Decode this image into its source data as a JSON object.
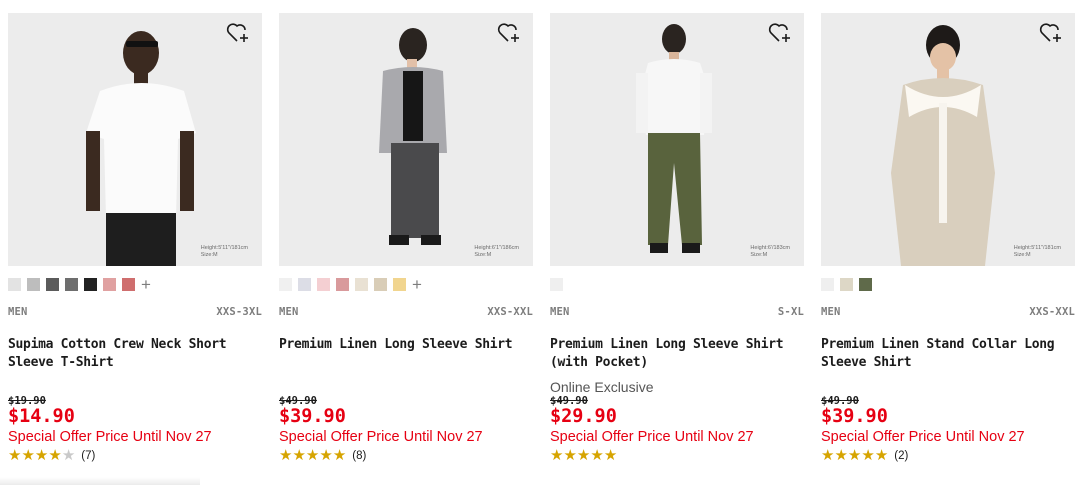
{
  "products": [
    {
      "gender": "MEN",
      "sizes": "XXS-3XL",
      "name": "Supima Cotton Crew Neck Short Sleeve T-Shirt",
      "exclusive": "",
      "old_price": "$19.90",
      "price": "$14.90",
      "offer": "Special Offer Price Until Nov 27",
      "stars": "★★★★★",
      "rating_value": 3.5,
      "reviews": "(7)",
      "model_note_1": "Height:5'11\"/181cm",
      "model_note_2": "Size:M",
      "swatches": [
        "#e3e3e3",
        "#bdbdbd",
        "#5b5b5b",
        "#6e6e6e",
        "#222222",
        "#e0a1a1",
        "#cf6e6e"
      ],
      "has_more_colors": true,
      "more_colors_label": "+"
    },
    {
      "gender": "MEN",
      "sizes": "XXS-XXL",
      "name": "Premium Linen Long Sleeve Shirt",
      "exclusive": "",
      "old_price": "$49.90",
      "price": "$39.90",
      "offer": "Special Offer Price Until Nov 27",
      "stars": "★★★★★",
      "rating_value": 5,
      "reviews": "(8)",
      "model_note_1": "Height:6'1\"/186cm",
      "model_note_2": "Size:M",
      "swatches": [
        "#f0f0f0",
        "#dcdde6",
        "#f4cfd2",
        "#d99a9c",
        "#e9e1d3",
        "#d9cdb7",
        "#f1d58f"
      ],
      "has_more_colors": true,
      "more_colors_label": "+"
    },
    {
      "gender": "MEN",
      "sizes": "S-XL",
      "name": "Premium Linen Long Sleeve Shirt (with Pocket)",
      "exclusive": "Online Exclusive",
      "old_price": "$49.90",
      "price": "$29.90",
      "offer": "Special Offer Price Until Nov 27",
      "stars": "★★★★★",
      "rating_value": 5,
      "reviews": "",
      "model_note_1": "Height:6'/183cm",
      "model_note_2": "Size:M",
      "swatches": [
        "#efefef"
      ],
      "has_more_colors": false,
      "more_colors_label": ""
    },
    {
      "gender": "MEN",
      "sizes": "XXS-XXL",
      "name": "Premium Linen Stand Collar Long Sleeve Shirt",
      "exclusive": "",
      "old_price": "$49.90",
      "price": "$39.90",
      "offer": "Special Offer Price Until Nov 27",
      "stars": "★★★★★",
      "rating_value": 5,
      "reviews": "(2)",
      "model_note_1": "Height:5'11\"/181cm",
      "model_note_2": "Size:M",
      "swatches": [
        "#efefef",
        "#ddd7c6",
        "#5f6a4a"
      ],
      "has_more_colors": false,
      "more_colors_label": ""
    }
  ],
  "colors": {
    "sale_red": "#e60012",
    "star_gold": "#d6a400",
    "muted_text": "#7d7d7d"
  },
  "icons": {
    "wishlist": "heart-plus-icon",
    "rating": "star-icon"
  }
}
